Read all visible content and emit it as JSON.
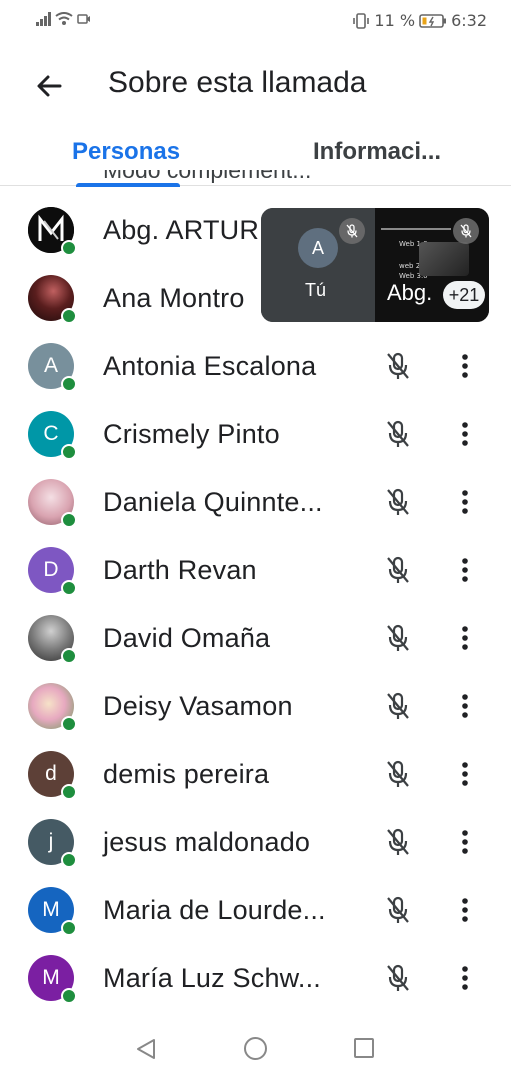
{
  "status_bar": {
    "battery_percent": "11 %",
    "time": "6:32"
  },
  "header": {
    "title": "Sobre esta llamada"
  },
  "tabs": [
    {
      "label": "Personas",
      "selected": true
    },
    {
      "label": "Informaci...",
      "selected": false
    }
  ],
  "cutoff_row": {
    "label": "Modo complement..."
  },
  "participants": [
    {
      "name": "Abg. ARTUR",
      "avatar_type": "logo",
      "online": true
    },
    {
      "name": "Ana Montro",
      "avatar_type": "photo",
      "online": true
    },
    {
      "name": "Antonia Escalona",
      "avatar_letter": "A",
      "avatar_color": "#78909c",
      "online": true
    },
    {
      "name": "Crismely Pinto",
      "avatar_letter": "C",
      "avatar_color": "#0097a7",
      "online": true
    },
    {
      "name": "Daniela Quinnte...",
      "avatar_type": "photo",
      "online": true
    },
    {
      "name": "Darth Revan",
      "avatar_letter": "D",
      "avatar_color": "#7e57c2",
      "online": true
    },
    {
      "name": "David Omaña",
      "avatar_type": "photo",
      "online": true
    },
    {
      "name": "Deisy Vasamon",
      "avatar_type": "photo",
      "online": true
    },
    {
      "name": "demis pereira",
      "avatar_letter": "d",
      "avatar_color": "#5d4037",
      "online": true
    },
    {
      "name": "jesus maldonado",
      "avatar_letter": "j",
      "avatar_color": "#455a64",
      "online": true
    },
    {
      "name": "Maria de Lourde...",
      "avatar_letter": "M",
      "avatar_color": "#1565c0",
      "online": true
    },
    {
      "name": "María Luz Schw...",
      "avatar_letter": "M",
      "avatar_color": "#7b1fa2",
      "online": true
    }
  ],
  "video_tiles": {
    "self": {
      "avatar_letter": "A",
      "label": "Tú"
    },
    "other": {
      "label": "Abg.",
      "more_count": "+21",
      "slide_lines": [
        "Web 1.0",
        "web 2.0",
        "Web 3.0"
      ]
    }
  },
  "icons": {
    "back": "arrow-back-icon",
    "mic_muted": "mic-off-icon",
    "more": "more-vert-icon"
  },
  "colors": {
    "accent": "#1a73e8",
    "online": "#1e8e3e"
  }
}
